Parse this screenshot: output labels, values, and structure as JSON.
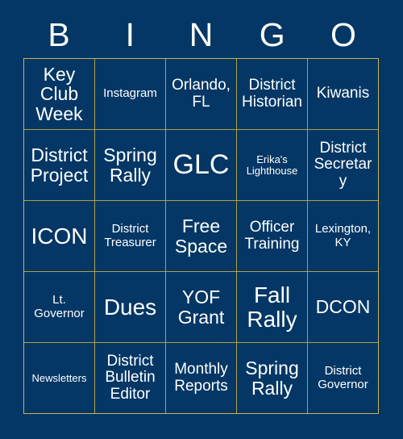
{
  "card": {
    "title_letters": [
      "B",
      "I",
      "N",
      "G",
      "O"
    ],
    "colors": {
      "background": "#043765",
      "grid_line": "#c9b458",
      "text": "#ffffff"
    },
    "grid": {
      "columns": 5,
      "rows": 5,
      "cells": [
        {
          "text": "Key Club Week",
          "size": "fs-l"
        },
        {
          "text": "Instagram",
          "size": "fs-s"
        },
        {
          "text": "Orlando, FL",
          "size": "fs-m"
        },
        {
          "text": "District Historian",
          "size": "fs-m"
        },
        {
          "text": "Kiwanis",
          "size": "fs-m"
        },
        {
          "text": "District Project",
          "size": "fs-l"
        },
        {
          "text": "Spring Rally",
          "size": "fs-l"
        },
        {
          "text": "GLC",
          "size": "fs-xxl"
        },
        {
          "text": "Erika's Lighthouse",
          "size": "fs-xs"
        },
        {
          "text": "District Secretary",
          "size": "fs-m"
        },
        {
          "text": "ICON",
          "size": "fs-xl"
        },
        {
          "text": "District Treasurer",
          "size": "fs-s"
        },
        {
          "text": "Free Space",
          "size": "fs-l"
        },
        {
          "text": "Officer Training",
          "size": "fs-m"
        },
        {
          "text": "Lexington, KY",
          "size": "fs-s"
        },
        {
          "text": "Lt. Governor",
          "size": "fs-s"
        },
        {
          "text": "Dues",
          "size": "fs-xl"
        },
        {
          "text": "YOF Grant",
          "size": "fs-l"
        },
        {
          "text": "Fall Rally",
          "size": "fs-xl"
        },
        {
          "text": "DCON",
          "size": "fs-l"
        },
        {
          "text": "Newsletters",
          "size": "fs-xs"
        },
        {
          "text": "District Bulletin Editor",
          "size": "fs-m"
        },
        {
          "text": "Monthly Reports",
          "size": "fs-m"
        },
        {
          "text": "Spring Rally",
          "size": "fs-l"
        },
        {
          "text": "District Governor",
          "size": "fs-s"
        }
      ]
    }
  }
}
